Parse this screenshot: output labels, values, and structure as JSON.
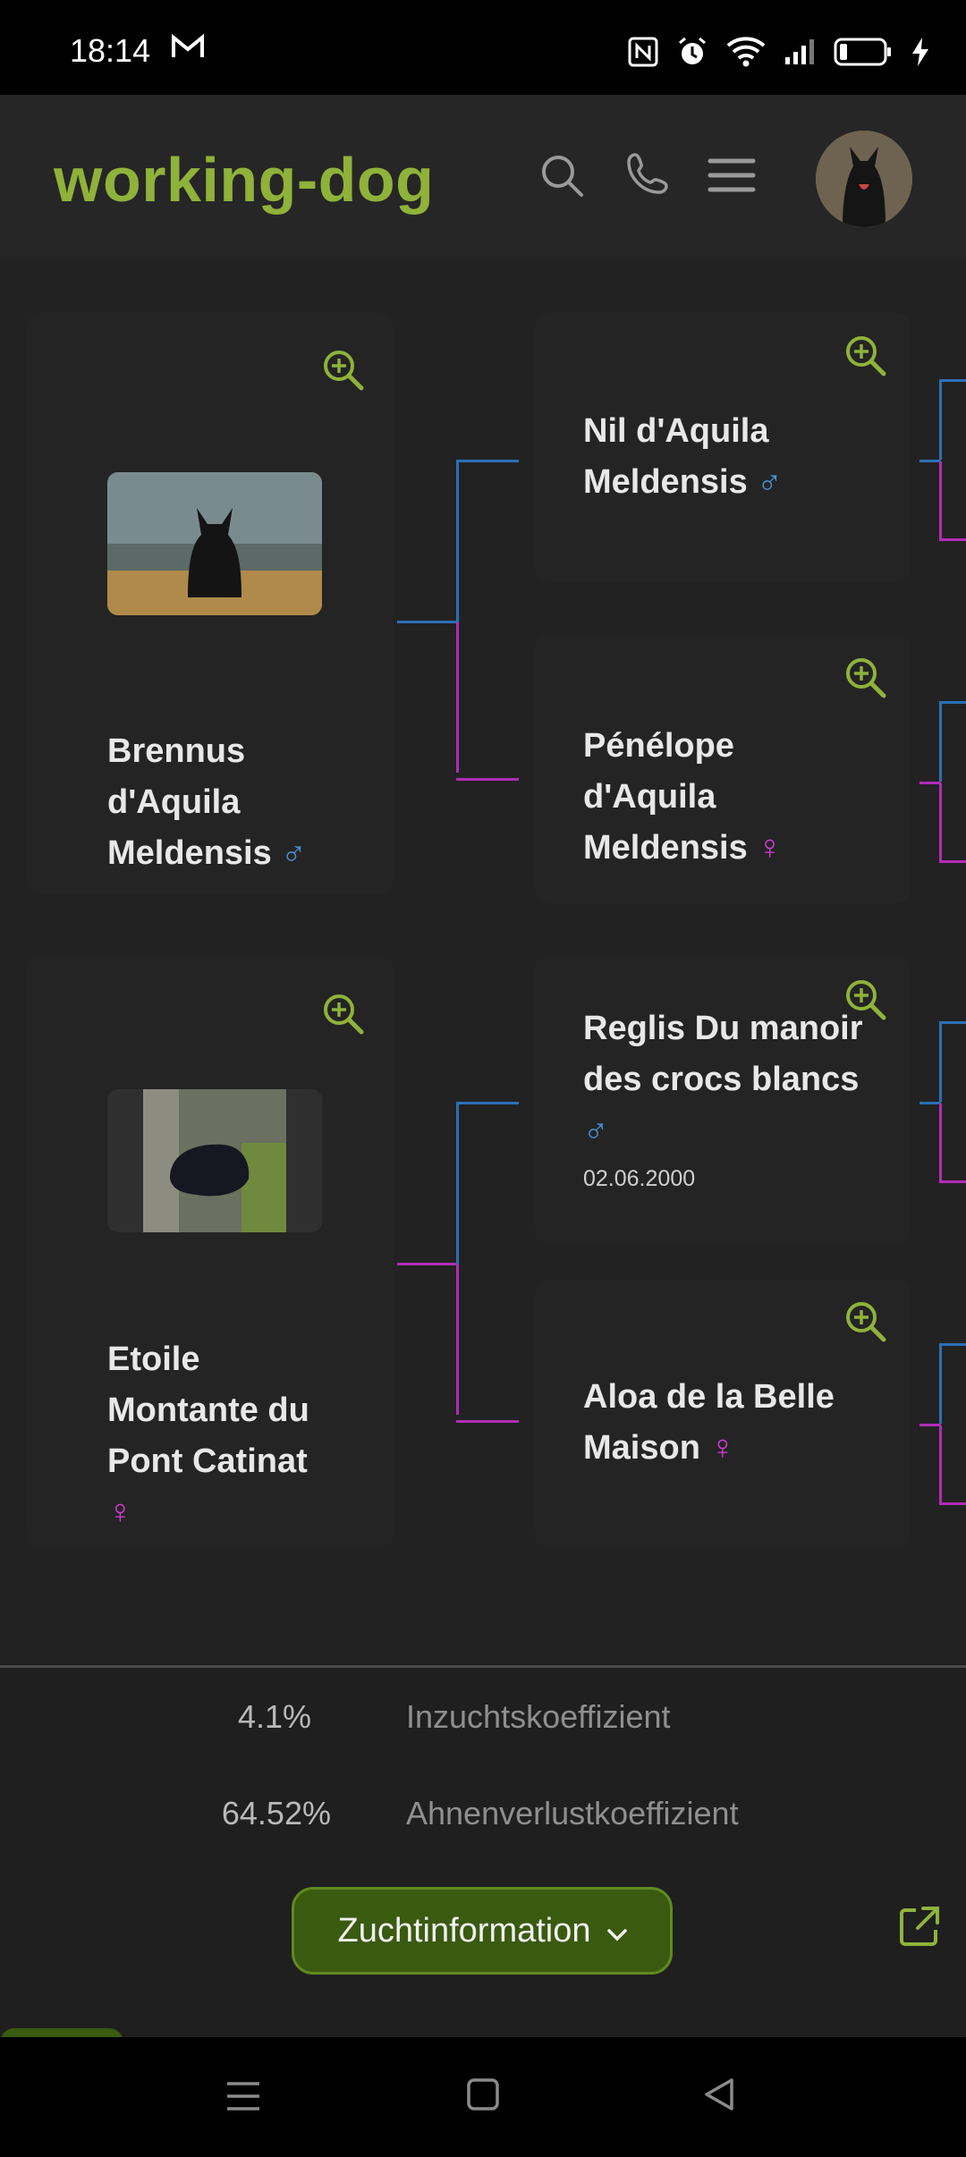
{
  "status_bar": {
    "time": "18:14",
    "notification_icon": "gmail-icon",
    "icons": [
      "nfc-icon",
      "alarm-icon",
      "wifi-icon",
      "signal-icon",
      "battery-icon",
      "charging-icon"
    ]
  },
  "header": {
    "logo": "working-dog",
    "icons": [
      "search-icon",
      "phone-icon",
      "menu-icon"
    ]
  },
  "pedigree": {
    "parents": [
      {
        "name": "Brennus d'Aquila Meldensis",
        "sex": "♂",
        "parents": [
          {
            "name": "Nil d'Aquila Meldensis",
            "sex": "♂"
          },
          {
            "name": "Pénélope d'Aquila Meldensis",
            "sex": "♀"
          }
        ]
      },
      {
        "name": "Etoile Montante du Pont Catinat",
        "sex": "♀",
        "parents": [
          {
            "name": "Reglis Du manoir des crocs blancs",
            "sex": "♂",
            "date": "02.06.2000"
          },
          {
            "name": "Aloa de la Belle Maison",
            "sex": "♀"
          }
        ]
      }
    ]
  },
  "stats": [
    {
      "value": "4.1%",
      "label": "Inzuchtskoeffizient"
    },
    {
      "value": "64.52%",
      "label": "Ahnenverlustkoeffizient"
    }
  ],
  "actions": {
    "zucht_button": "Zuchtinformation",
    "zucht_chevron": "⌄"
  },
  "colors": {
    "accent": "#8fb23a",
    "male": "#4a90d9",
    "female": "#d33cd3",
    "button_bg": "#3a5a10"
  }
}
